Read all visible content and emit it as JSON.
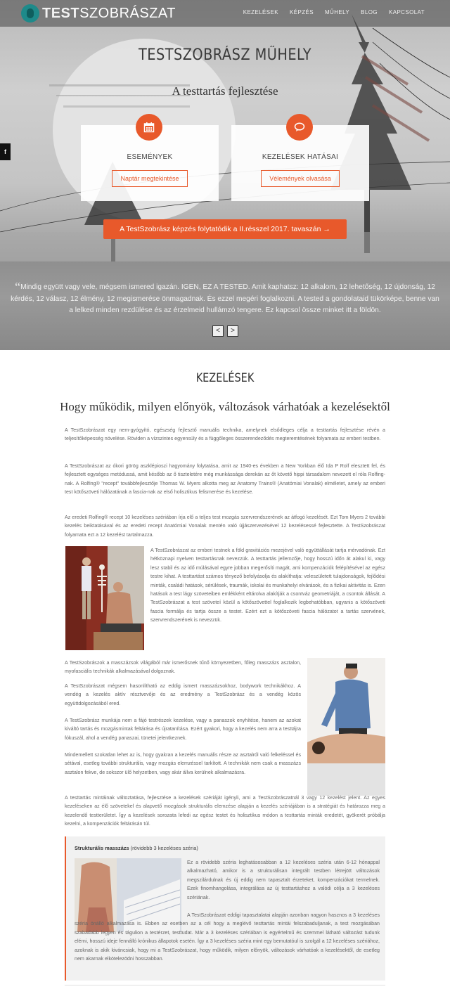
{
  "nav": {
    "logo_bold": "TEST",
    "logo_rest": "SZOBRÁSZAT",
    "items": [
      "KEZELÉSEK",
      "KÉPZÉS",
      "MŰHELY",
      "BLOG",
      "KAPCSOLAT"
    ]
  },
  "social": {
    "facebook": "f"
  },
  "hero": {
    "title": "TESTSZOBRÁSZ MŰHELY",
    "subtitle": "A testtartás fejlesztése",
    "cards": [
      {
        "icon": "calendar-icon",
        "title": "ESEMÉNYEK",
        "button": "Naptár megtekintése"
      },
      {
        "icon": "speech-bubble-icon",
        "title": "KEZELÉSEK HATÁSAI",
        "button": "Vélemények olvasása"
      }
    ],
    "cta": "A TestSzobrász képzés folytatódik a II.résszel 2017. tavaszán →"
  },
  "quote": {
    "mark": "“",
    "text": "Mindig együtt vagy vele, mégsem ismered igazán. IGEN, EZ A TESTED. Amit kaphatsz: 12 alkalom, 12 lehetőség, 12 újdonság, 12 kérdés, 12 válasz, 12 élmény, 12 megismerése önmagadnak. És ezzel megéri foglalkozni. A tested a gondolataid tükörképe, benne van a lelked minden rezdülése és az érzelmeid hullámzó tengere. Ez kapcsol össze minket itt a földön.",
    "prev": "<",
    "next": ">"
  },
  "section": {
    "title": "KEZELÉSEK",
    "subtitle": "Hogy működik, milyen előnyök, változások várhatóak a kezelésektől",
    "p1": "A TestSzobrászat egy nem-gyógyító, egészség fejlesztő manuális technika, amelynek elsődleges célja a testtartás fejlesztése révén a teljesítőképesség növelése. Röviden a vízszintes egyensúly és a függőleges összerendeződés megteremtésének folyamata az emberi testben.",
    "p2": "A TestSzobrászat az ókori görög aszklépioszi hagyomány folytatása, amit az 1940-es években a New Yorkban élő Ida P Rolf elesztett fel, és fejlesztett egységes metódussá, amit később az ő tiszteletére még munkássága derekán az őt követő hippi társadalom nevezett el róla Rolfing-nak. A Rolfing® \"recept\" továbbfejlesztője Thomas W. Myers alkotta meg az Anatomy Trains® (Anatómiai Vonalak) elméletet, amely az emberi test kötőszöveti hálózatának a fascia-nak az első holisztikus felismerése és kezelése.",
    "p3": "Az eredeti Rolfing® recept 10 kezeléses szériában írja elő a teljes test mozgás szervrendszerének az átfogó kezelését. Ezt Tom Myers 2 további kezelés beiktatásával és az eredeti recept Anatómiai Vonalak mentén való újjászervezésével 12 kezelésessé fejlesztette. A TestSzobrászat folyamata ezt a 12 kezelést tartalmazza.",
    "p4": "A TestSzobrászat az emberi testnek a föld gravitációs mezejével való együttállását tartja mérvadónak. Ezt hétköznapi nyelven testtartásnak nevezzük. A testtartás jellemzője, hogy hosszú időn át alakul ki, vagy lesz stabil és az idő múlásával egyre jobban megerősíti magát, ami kompenzációk felépítésével az egész testre kihat. A testtartást számos tényező befolyásolja és alakíthatja: veleszületett tulajdonságok, fejlődési minták, családi hatások, sérülések, traumák, iskolai és munkahelyi elvárások, és a fizikai aktivitás is. Ezen hatások a test lágy szöveteiben emlékként eltárolva alakítják a csontváz geometriáját, a csontok állását. A TestSzobrászat a test szöveteí közül a kötőszövettel foglalkozik legbehatóbban, ugyanis a kötőszöveti fascia formálja és tartja össze a testet. Ezért ezt a kötőszöveti fascia hálózatot a tartás szervének, szervrendszerének is nevezzük.",
    "p5": "A TestSzobrászok a masszázsok világából már ismerősnek tűnő környezetben, főleg masszázs asztalon, myofasciális technikák alkalmazásával dolgoznak.",
    "p6": "A TestSzobrászat mégsem hasonlítható az eddig ismert masszázsokhoz, bodywork technikákhoz. A vendég a kezelés aktív résztvevője és az eredmény a TestSzobrász és a vendég közös együttdolgozásából ered.",
    "p7": "A TestSzobrász munkája nem a fájó testrészek kezelése, vagy a panaszok enyhítése, hanem az azokat kiváltó tartás és mozgásmintak feltárása és újratanítása. Ezért gyakori, hogy a kezelés nem arra a testtájra fókuszál, ahol a vendég panaszai, tünetei jelentkeznek.",
    "p8": "Mindemellett szokatlan lehet az is, hogy gyakran a kezelés manuális része az asztalról való felkeléssel és sétával, esetleg további strukturális, vagy mozgás elemzéssel tarkított. A technikák nem csak a masszázs asztalon fekve, de sokszor ülő helyzetben, vagy akár állva kerülnek alkalmazásra.",
    "p9": "A testtartás mintáinak változtatása, fejlesztése a kezelések szériáját igényli, ami a TestSzobrászatnál 3 vagy 12 kezelést jelent. Az egyes kezeléseken az élő szövetekel és alapvető mozgások strukturális elemzése alapján a kezelés szériájában is a stratégiát és határozza meg a kezelendő testterületet. Így a kezelések sorozata lefedi az egész testet és holisztikus módon a testtartás minták eredetét, gyökerét próbálja kezelni, a kompenzációk feltárásán túl."
  },
  "box": {
    "title": "Strukturális masszázs",
    "title_note": " (rövidebb 3 kezeléses széria)",
    "p1": "Ez a rövidebb széria leghatásosabban a 12 kezeléses széria után 6-12 hónappal alkalmazható, amikor is a strukturálisan integrált testben létrejött változások megszilárdulnak és új eddig nem tapasztalt érzeteket, kompenzációkat termelnek. Ezek finomhangolása, integrálása az új testtartáshoz a valódi célja a 3 kezeléses szériának.",
    "p2": "A TestSzobrászat eddigi tapasztalatai alapján azonban nagyon hasznos a 3 kezeléses széria önálló alkalmazása is. Ebben az esetben az a cél hogy a meglévő testtartás mintái felszabaduljanak, a test mozgásában szabadabb legyen és tágulion a testérzet, testtudat. Már a 3 kezeléses szériában is egyértelmű és szemmel látható változást tudunk elérni, hosszú ideje fennálló krónikus állapotok esetén. Így a 3 kezeléses széria mint egy bemutatóul is szolgál a 12 kezeléses szériához, azoknak is akik kiváncsiak, hogy mi a TestSzobrászat, hogy működik, milyen előnyök, változások várhatóak a kezelésektől, de esetleg nem akarnak elkötelezödni hosszabban."
  },
  "colors": {
    "accent": "#e8592b",
    "nav_bg": "#464646",
    "teal": "#1e8a8a"
  }
}
